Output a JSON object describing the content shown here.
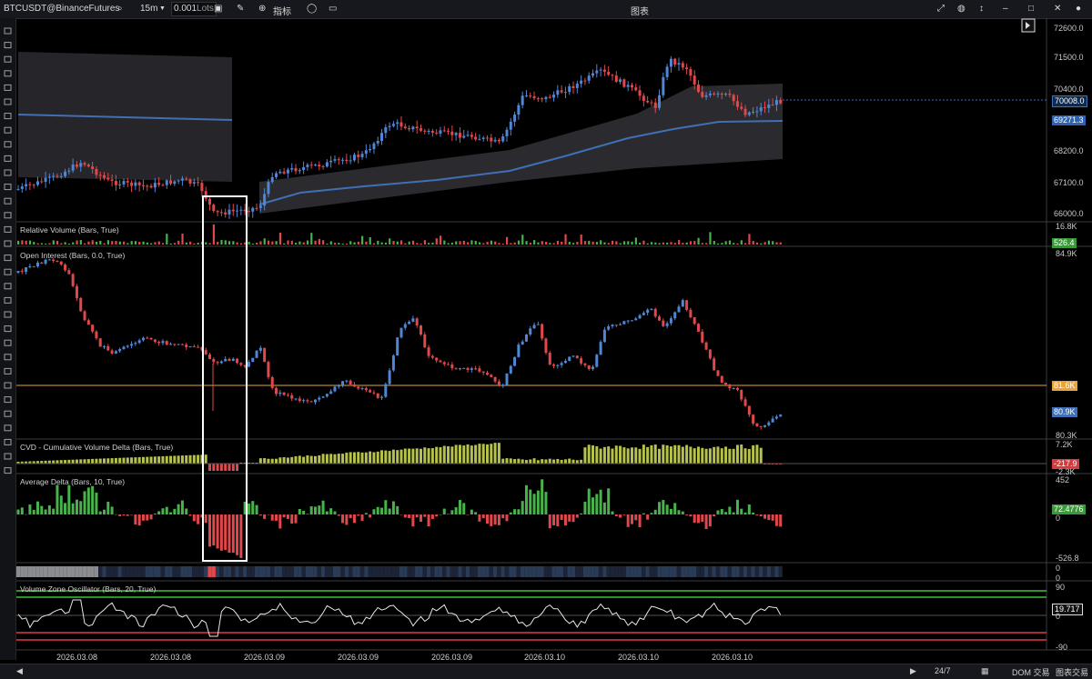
{
  "toolbar": {
    "symbol": "BTCUSDT@BinanceFutures",
    "search_icon": "search-icon",
    "timeframe": "15m",
    "lots_value": "0.001",
    "lots_label": "Lots",
    "indicators_label": "指标",
    "window_title": "图表"
  },
  "price_axis": {
    "ticks": [
      "72600.0",
      "71500.0",
      "70400.0",
      "69300.0",
      "68200.0",
      "67100.0",
      "66000.0"
    ],
    "last_price": "70008.0",
    "vwap_price": "69271.3"
  },
  "panels": {
    "relative_volume": {
      "title": "Relative Volume (Bars, True)",
      "top": "16.8K",
      "value": "526.4"
    },
    "open_interest": {
      "title": "Open Interest (Bars, 0.0, True)",
      "top": "84.9K",
      "level": "81.6K",
      "value": "80.9K",
      "bottom": "80.3K"
    },
    "cvd": {
      "title": "CVD - Cumulative Volume Delta (Bars, True)",
      "top": "7.2K",
      "value": "-217.9",
      "bottom": "-2.3K"
    },
    "avg_delta": {
      "title": "Average Delta (Bars, 10, True)",
      "top": "452",
      "zero": "0",
      "value": "72.4776",
      "bottom": "-526.8"
    },
    "heat_strip": {
      "top": "0",
      "bottom": "0"
    },
    "vzo": {
      "title": "Volume Zone Oscillator (Bars, 20, True)",
      "top": "90",
      "zero": "0",
      "value": "19.717",
      "bottom": "-90"
    }
  },
  "date_labels": [
    "2026.03.08",
    "2026.03.08",
    "2026.03.09",
    "2026.03.09",
    "2026.03.09",
    "2026.03.10",
    "2026.03.10",
    "2026.03.10"
  ],
  "statusbar": {
    "session": "24/7",
    "dom_label": "DOM 交易",
    "chart_trade_label": "图表交易"
  },
  "colors": {
    "bull": "#4f86d6",
    "bear": "#e0484b",
    "delta_pos": "#48b34a",
    "delta_neg": "#e0484b",
    "cvd_pos": "#b7c24a",
    "oi_level": "#e8a33c",
    "vwap": "#3f6fb5",
    "band": "#2b2b2f",
    "vzo_line": "#e8e8e8",
    "ob": "#3ac23a",
    "os": "#e33a3a"
  },
  "icons": [
    "line-icon",
    "ray-icon",
    "vertical-line-icon",
    "horizontal-line-icon",
    "arrow-icon",
    "crosshair-icon",
    "channel-icon",
    "pitchfork-icon",
    "fib-icon",
    "brush-icon",
    "triangle-icon",
    "rectangle-icon",
    "ellipse-icon",
    "text-icon",
    "tag-icon",
    "callout-icon"
  ]
}
